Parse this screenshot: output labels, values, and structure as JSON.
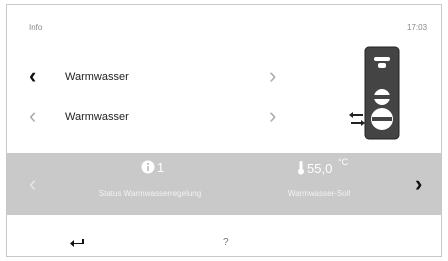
{
  "header": {
    "left_label": "Info",
    "time": "17:03"
  },
  "rows": [
    {
      "label": "Warmwasser"
    },
    {
      "label": "Warmwasser"
    }
  ],
  "status_band": {
    "left_value": "1",
    "left_caption": "Status Warmwasserregelung",
    "right_value": "55,0",
    "right_unit": "°C",
    "right_caption": "Warmwasser-Soll"
  },
  "footer": {
    "help_label": "?"
  },
  "icons": {
    "back": "back-arrow-icon",
    "info": "info-icon",
    "thermometer": "thermometer-icon",
    "boiler": "boiler-tank-icon"
  }
}
